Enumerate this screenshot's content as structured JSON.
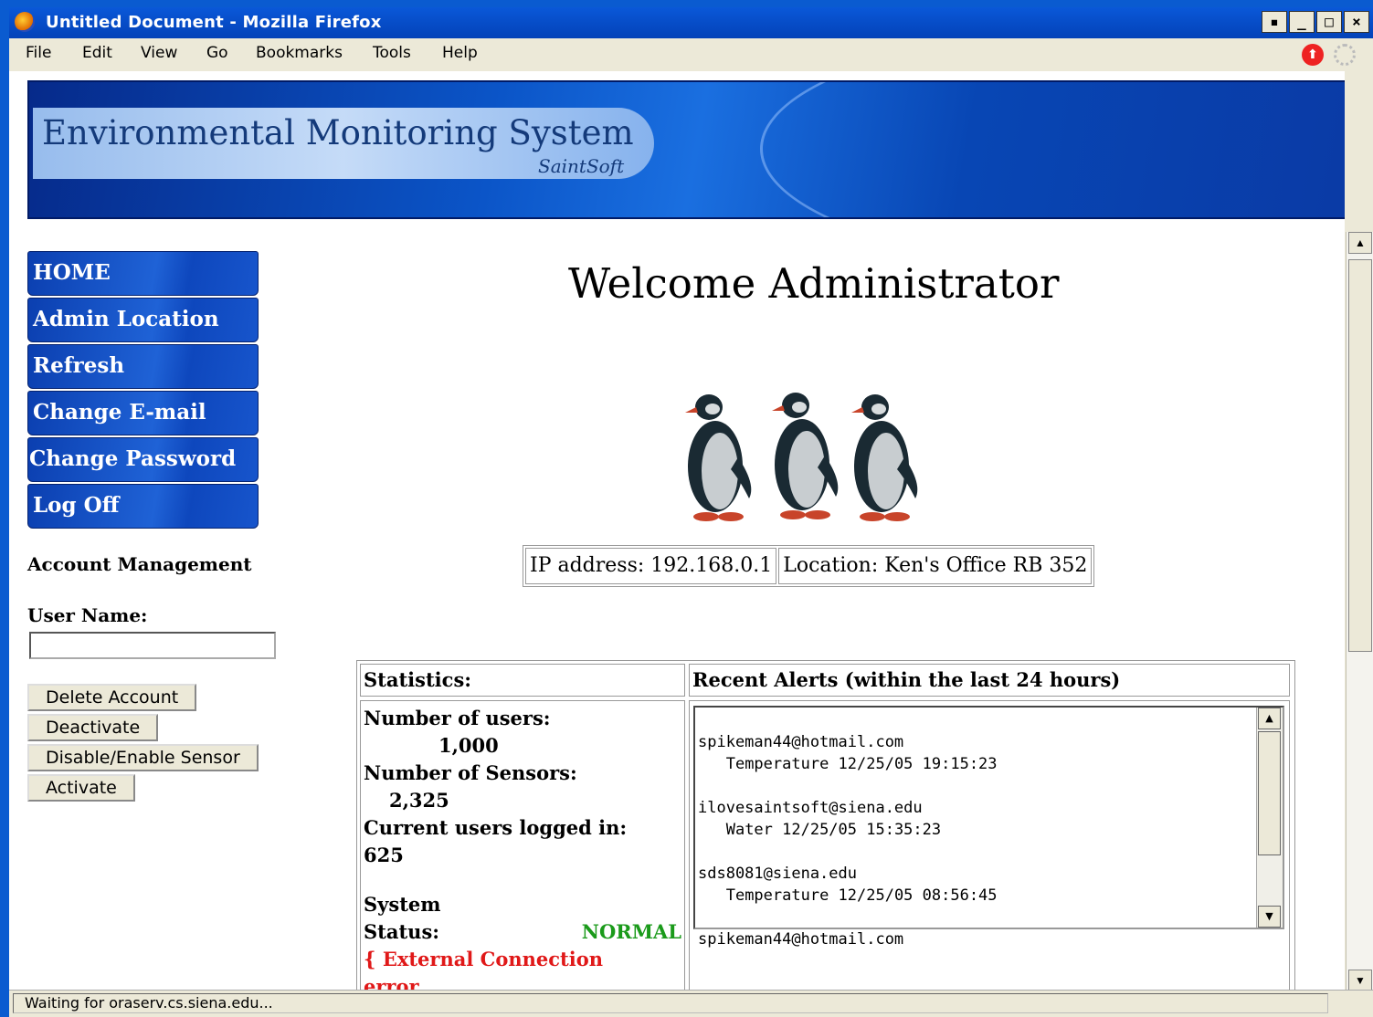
{
  "window": {
    "title": "Untitled Document - Mozilla Firefox"
  },
  "menu": [
    "File",
    "Edit",
    "View",
    "Go",
    "Bookmarks",
    "Tools",
    "Help"
  ],
  "banner": {
    "title": "Environmental Monitoring System",
    "subtitle": "SaintSoft"
  },
  "nav": [
    "HOME",
    "Admin Location",
    "Refresh",
    "Change E-mail",
    "Change Password",
    "Log Off"
  ],
  "account": {
    "title": "Account Management",
    "user_label": "User Name:",
    "user_value": "",
    "buttons": [
      "Delete Account",
      "Deactivate",
      "Disable/Enable Sensor",
      "Activate"
    ]
  },
  "welcome": "Welcome Administrator",
  "info": {
    "ip": "IP address: 192.168.0.1",
    "location": "Location: Ken's Office RB 352"
  },
  "stats": {
    "header": "Statistics:",
    "users_label": "Number of users:",
    "users_value": "1,000",
    "sensors_label": "Number of Sensors:",
    "sensors_value": "2,325",
    "logged_label": "Current users logged in:",
    "logged_value": "625",
    "system_label": "System",
    "status_label": "Status:",
    "status_value": "NORMAL",
    "error_line1": "{ External Connection",
    "error_line2": "error."
  },
  "alerts": {
    "header": "Recent Alerts (within the last 24 hours)",
    "items": [
      {
        "email": "spikeman44@hotmail.com",
        "detail": "Temperature 12/25/05 19:15:23"
      },
      {
        "email": "ilovesaintsoft@siena.edu",
        "detail": "Water 12/25/05 15:35:23"
      },
      {
        "email": "sds8081@siena.edu",
        "detail": "Temperature 12/25/05 08:56:45"
      },
      {
        "email": "spikeman44@hotmail.com",
        "detail": ""
      }
    ]
  },
  "status_bar": "Waiting for oraserv.cs.siena.edu..."
}
